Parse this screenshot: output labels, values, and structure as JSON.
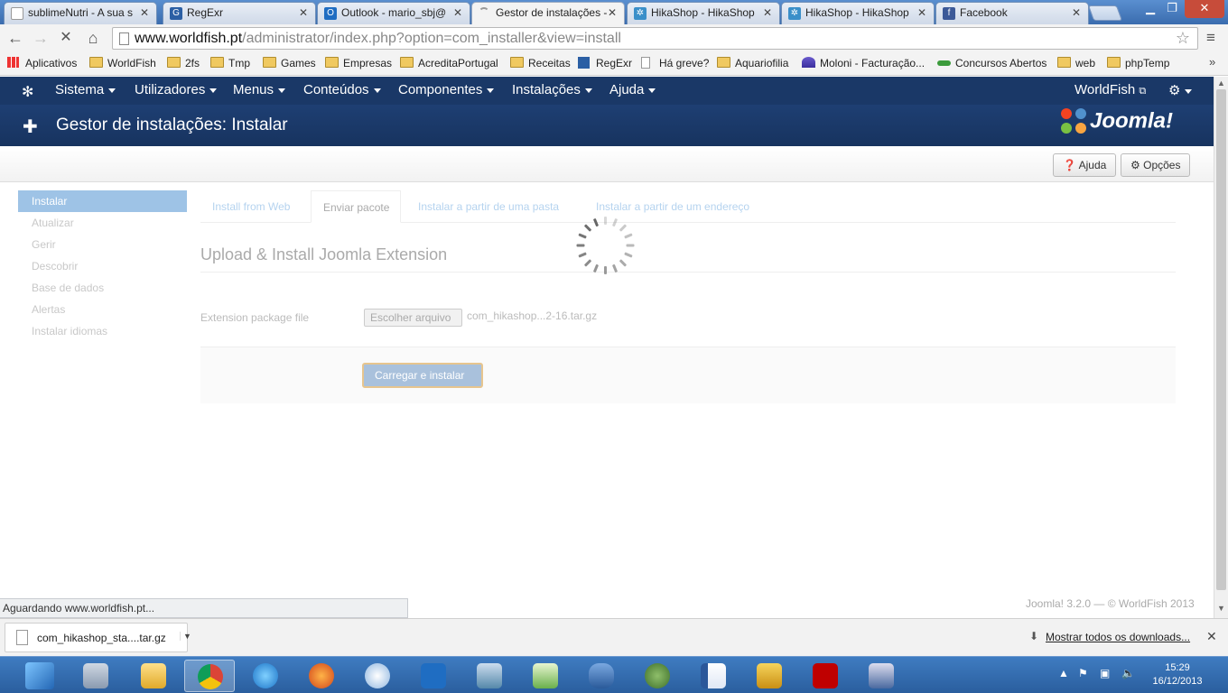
{
  "browser": {
    "tabs": [
      {
        "title": "sublimeNutri - A sua s",
        "icon": "page-icon",
        "active": false
      },
      {
        "title": "RegExr",
        "icon": "regexr-icon",
        "active": false
      },
      {
        "title": "Outlook - mario_sbj@",
        "icon": "outlook-icon",
        "active": false
      },
      {
        "title": "Gestor de instalações -",
        "icon": "loading-icon",
        "active": true
      },
      {
        "title": "HikaShop - HikaShop",
        "icon": "hikashop-icon",
        "active": false
      },
      {
        "title": "HikaShop - HikaShop",
        "icon": "hikashop-icon",
        "active": false
      },
      {
        "title": "Facebook",
        "icon": "facebook-icon",
        "active": false
      }
    ],
    "url_host": "www.worldfish.pt",
    "url_path": "/administrator/index.php?option=com_installer&view=install",
    "bookmarks": [
      {
        "label": "Aplicativos",
        "icon": "apps-icon"
      },
      {
        "label": "WorldFish",
        "icon": "folder-icon"
      },
      {
        "label": "2fs",
        "icon": "folder-icon"
      },
      {
        "label": "Tmp",
        "icon": "folder-icon"
      },
      {
        "label": "Games",
        "icon": "folder-icon"
      },
      {
        "label": "Empresas",
        "icon": "folder-icon"
      },
      {
        "label": "AcreditaPortugal",
        "icon": "folder-icon"
      },
      {
        "label": "Receitas",
        "icon": "folder-icon"
      },
      {
        "label": "RegExr",
        "icon": "regexr-icon"
      },
      {
        "label": "Há greve?",
        "icon": "page-icon"
      },
      {
        "label": "Aquariofilia",
        "icon": "folder-icon"
      },
      {
        "label": "Moloni - Facturação...",
        "icon": "moloni-icon"
      },
      {
        "label": "Concursos Abertos",
        "icon": "concursos-icon"
      },
      {
        "label": "web",
        "icon": "folder-icon"
      },
      {
        "label": "phpTemp",
        "icon": "folder-icon"
      }
    ],
    "more_bookmarks": "»",
    "status_text": "Aguardando www.worldfish.pt...",
    "download": {
      "filename": "com_hikashop_sta....tar.gz",
      "show_all": "Mostrar todos os downloads..."
    }
  },
  "joomla": {
    "menu": [
      "Sistema",
      "Utilizadores",
      "Menus",
      "Conteúdos",
      "Componentes",
      "Instalações",
      "Ajuda"
    ],
    "site_link": "WorldFish",
    "page_title": "Gestor de instalações: Instalar",
    "brand": "Joomla!",
    "toolbar": {
      "help": "Ajuda",
      "options": "Opções"
    },
    "sidebar": [
      "Instalar",
      "Atualizar",
      "Gerir",
      "Descobrir",
      "Base de dados",
      "Alertas",
      "Instalar idiomas"
    ],
    "tabs": [
      "Install from Web",
      "Enviar pacote",
      "Instalar a partir de uma pasta",
      "Instalar a partir de um endereço"
    ],
    "active_tab_index": 1,
    "heading": "Upload & Install Joomla Extension",
    "field_label": "Extension package file",
    "file_button": "Escolher arquivo",
    "file_name": "com_hikashop...2-16.tar.gz",
    "submit": "Carregar e instalar",
    "footer": "Joomla! 3.2.0 — © WorldFish 2013"
  },
  "taskbar": {
    "time": "15:29",
    "date": "16/12/2013",
    "apps": [
      "calculator-icon",
      "explorer-icon",
      "chrome-icon",
      "ie-icon",
      "firefox-icon",
      "safari-icon",
      "outlook-icon",
      "virtualbox-icon",
      "notepad-icon",
      "database-icon",
      "turtle-icon",
      "word-icon",
      "puzzle-icon",
      "filezilla-icon",
      "remote-desktop-icon"
    ]
  },
  "colors": {
    "joomla_nav": "#1a3867",
    "active_side": "#9ec3e6",
    "taskbar": "#2a5e9e"
  }
}
